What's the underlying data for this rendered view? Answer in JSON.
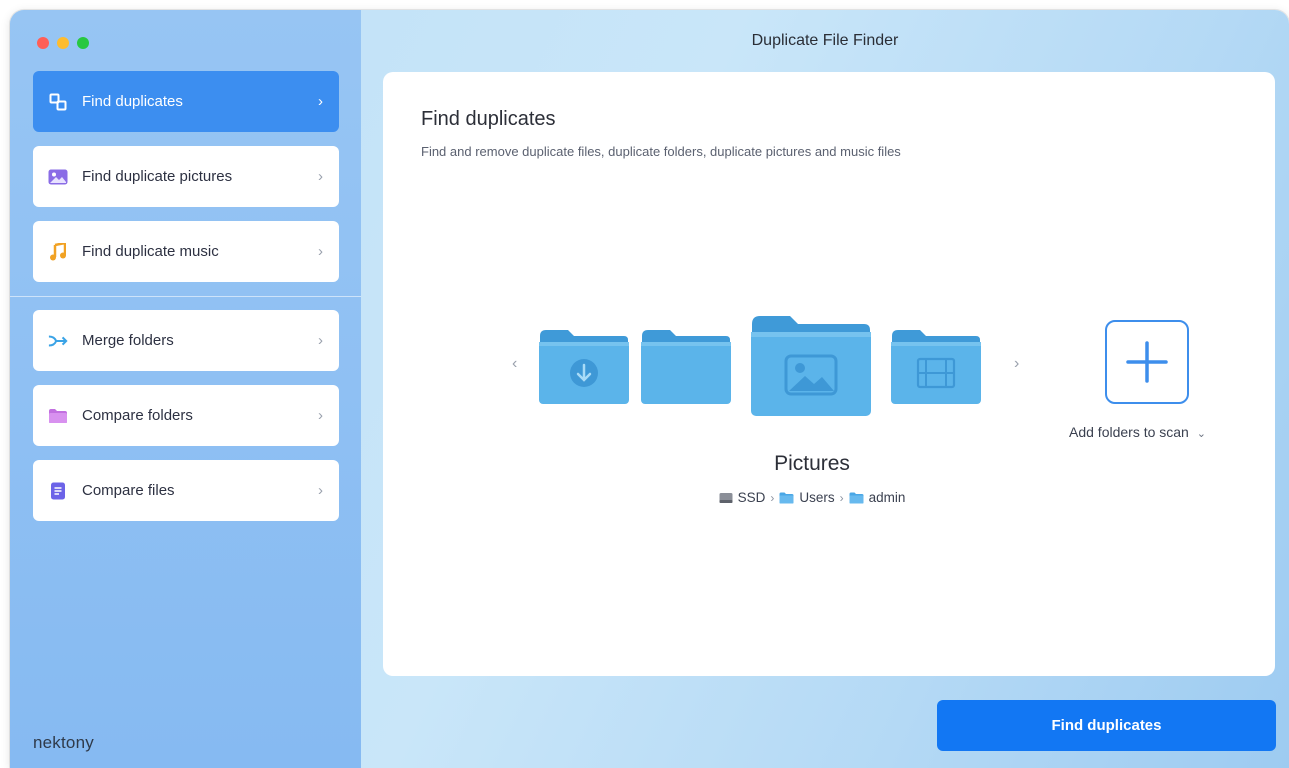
{
  "window": {
    "title": "Duplicate File Finder"
  },
  "sidebar": {
    "items": [
      {
        "label": "Find duplicates",
        "icon": "duplicate-icon",
        "active": true
      },
      {
        "label": "Find duplicate pictures",
        "icon": "picture-icon",
        "active": false
      },
      {
        "label": "Find duplicate music",
        "icon": "music-note-icon",
        "active": false
      },
      {
        "label": "Merge folders",
        "icon": "merge-arrow-icon",
        "active": false
      },
      {
        "label": "Compare folders",
        "icon": "folder-icon",
        "active": false
      },
      {
        "label": "Compare files",
        "icon": "document-icon",
        "active": false
      }
    ],
    "brand": "nektony"
  },
  "main": {
    "title": "Find duplicates",
    "subtitle": "Find and remove duplicate files, duplicate folders, duplicate pictures and music files",
    "carousel": {
      "folders": [
        "downloads-folder-icon",
        "generic-folder-icon",
        "pictures-folder-icon",
        "movies-folder-icon"
      ],
      "selected_name": "Pictures",
      "path": [
        {
          "label": "SSD",
          "icon": "drive-icon"
        },
        {
          "label": "Users",
          "icon": "folder-icon"
        },
        {
          "label": "admin",
          "icon": "folder-icon"
        }
      ]
    },
    "add_folders_label": "Add folders to scan",
    "primary_button": "Find duplicates"
  },
  "colors": {
    "accent": "#1277f3",
    "active_item": "#3c8ef0",
    "folder_blue": "#5bb4ea"
  }
}
